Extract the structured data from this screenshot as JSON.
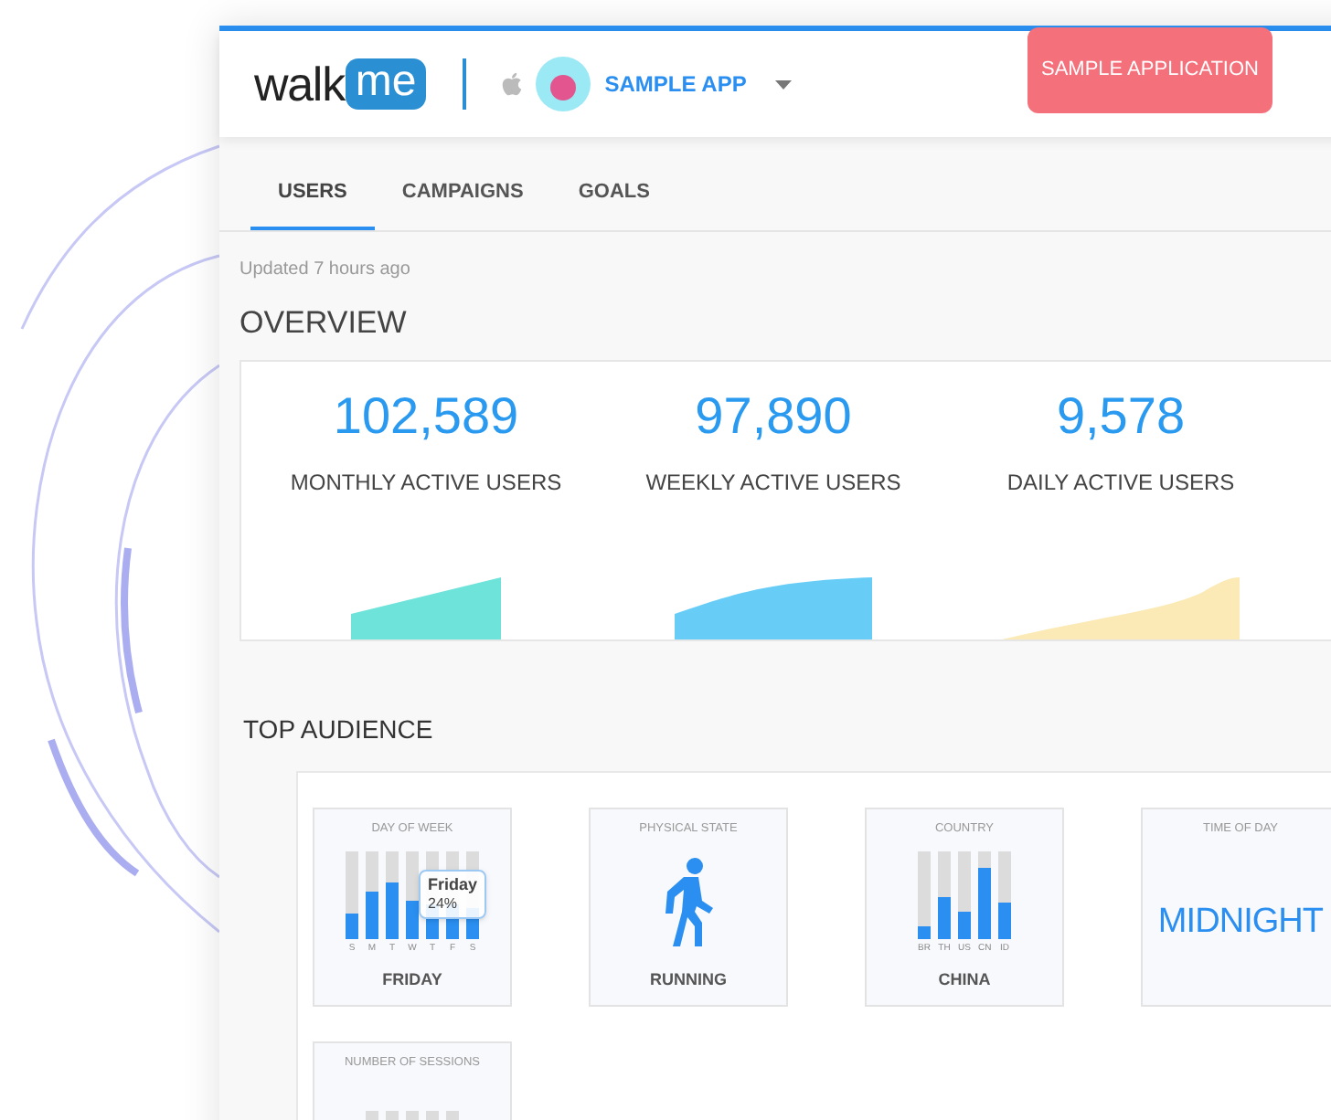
{
  "header": {
    "logo": {
      "word": "walk",
      "badge": "me"
    },
    "app_name": "SAMPLE APP",
    "action_button": "SAMPLE APPLICATION"
  },
  "tabs": [
    {
      "label": "USERS",
      "selected": true
    },
    {
      "label": "CAMPAIGNS",
      "selected": false
    },
    {
      "label": "GOALS",
      "selected": false
    }
  ],
  "updated": "Updated 7 hours ago",
  "overview": {
    "title": "OVERVIEW",
    "stats": [
      {
        "value": "102,589",
        "label": "MONTHLY ACTIVE USERS",
        "color": "#6ee3d9"
      },
      {
        "value": "97,890",
        "label": "WEEKLY ACTIVE USERS",
        "color": "#68cdf6"
      },
      {
        "value": "9,578",
        "label": "DAILY ACTIVE USERS",
        "color": "#fbeab5"
      }
    ]
  },
  "audience": {
    "title": "TOP AUDIENCE",
    "cards": [
      {
        "kind": "bars",
        "title": "DAY OF WEEK",
        "bar_labels": [
          "S",
          "M",
          "T",
          "W",
          "T",
          "F",
          "S"
        ],
        "tooltip": {
          "title": "Friday",
          "value": "24%"
        },
        "result": "FRIDAY"
      },
      {
        "kind": "icon",
        "title": "PHYSICAL STATE",
        "result": "RUNNING"
      },
      {
        "kind": "bars",
        "title": "COUNTRY",
        "bar_labels": [
          "BR",
          "TH",
          "US",
          "CN",
          "ID"
        ],
        "result": "CHINA"
      },
      {
        "kind": "big",
        "title": "TIME OF DAY",
        "result": "MIDNIGHT"
      },
      {
        "kind": "bars",
        "title": "NUMBER OF SESSIONS"
      }
    ]
  }
}
